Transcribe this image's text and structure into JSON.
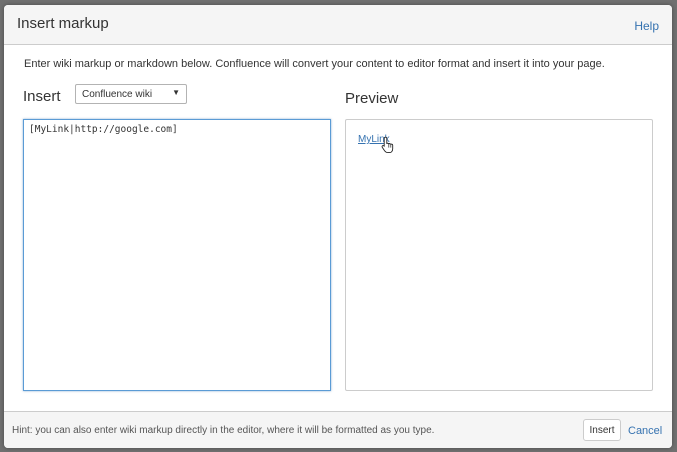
{
  "dialog": {
    "title": "Insert markup",
    "help_label": "Help",
    "description": "Enter wiki markup or markdown below. Confluence will convert your content to editor format and insert it into your page."
  },
  "insert": {
    "heading": "Insert",
    "format_select": {
      "selected": "Confluence wiki",
      "arrow_icon": "triangle-down-icon"
    },
    "markup_value": "[MyLink|http://google.com]"
  },
  "preview": {
    "heading": "Preview",
    "link_text": "MyLink",
    "cursor_icon": "hand-pointer-icon"
  },
  "footer": {
    "hint": "Hint: you can also enter wiki markup directly in the editor, where it will be formatted as you type.",
    "insert_label": "Insert",
    "cancel_label": "Cancel"
  },
  "colors": {
    "link": "#3572b0",
    "text": "#333333",
    "focus_border": "#5b9bd5",
    "chrome_background": "#f5f5f5",
    "overlay": "#707070"
  }
}
